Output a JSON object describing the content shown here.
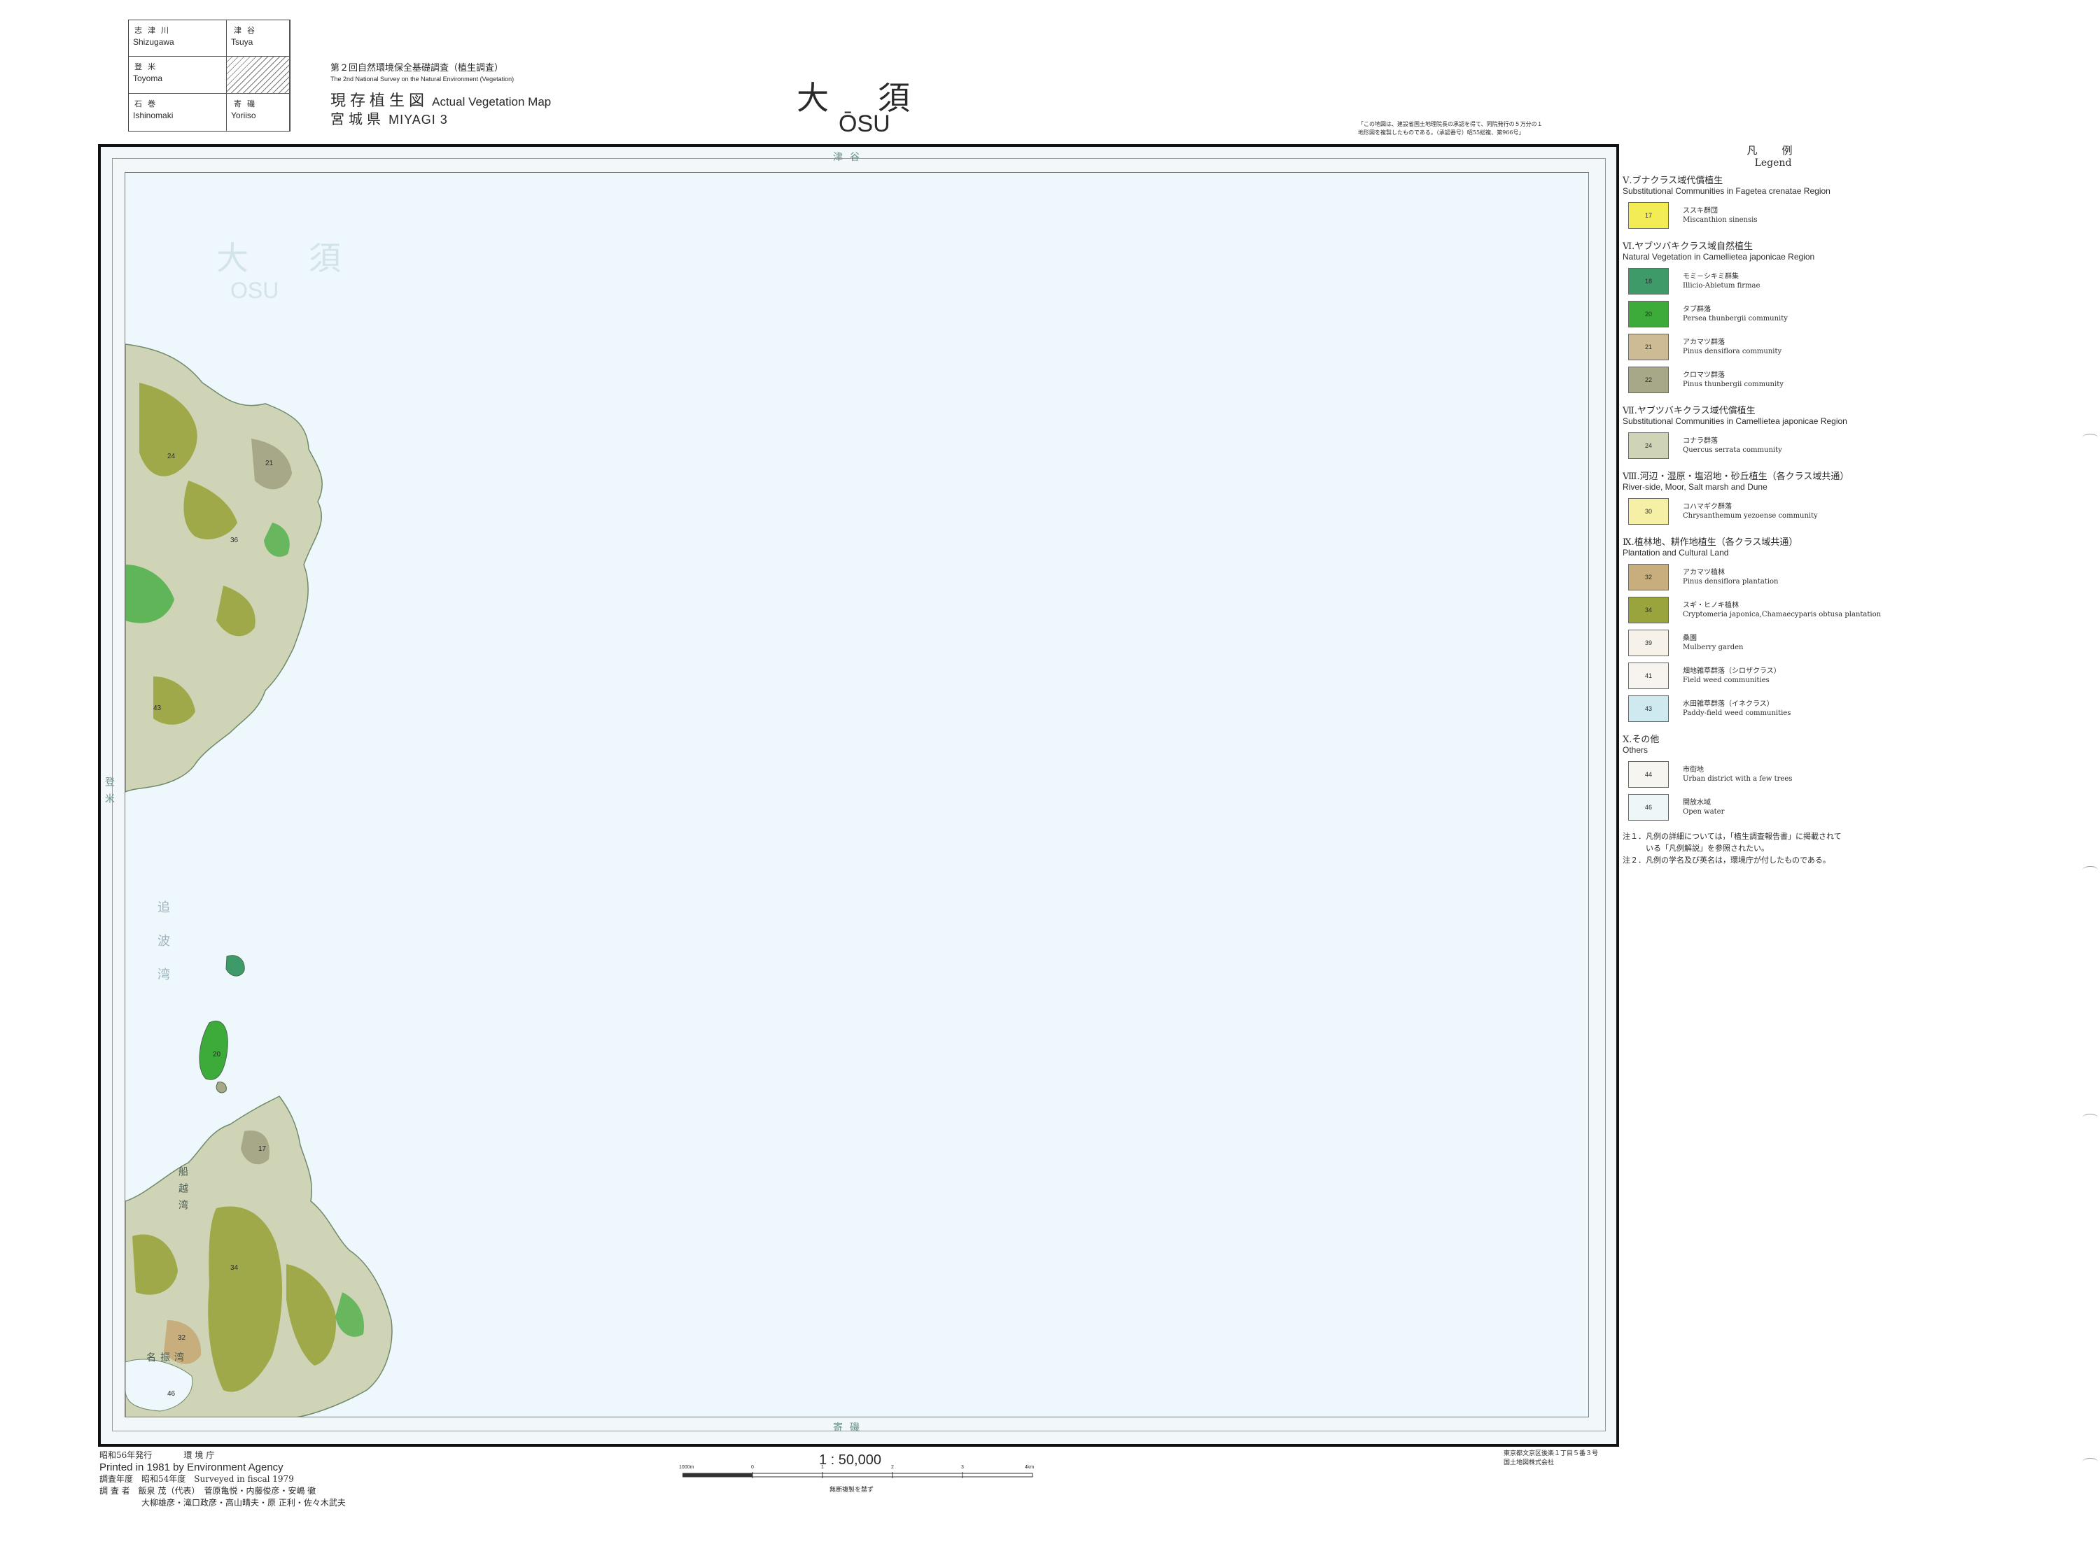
{
  "index_sheet": {
    "cells": [
      {
        "jp": "志津川",
        "en": "Shizugawa"
      },
      {
        "jp": "津谷",
        "en": "Tsuya"
      },
      {
        "jp": "登米",
        "en": "Toyoma"
      },
      {
        "jp": "",
        "en": ""
      },
      {
        "jp": "石巻",
        "en": "Ishinomaki"
      },
      {
        "jp": "寄磯",
        "en": "Yoriiso"
      }
    ]
  },
  "survey": {
    "title_jp": "第２回自然環境保全基礎調査（植生調査）",
    "title_en": "The 2nd National Survey on the Natural Environment (Vegetation)",
    "map_type_jp": "現存植生図",
    "map_type_en": "Actual Vegetation Map",
    "prefecture_jp": "宮城県",
    "prefecture_en": "MIYAGI 3"
  },
  "sheet": {
    "name_jp": "大須",
    "name_en": "ŌSU"
  },
  "copyright_note": [
    "「この地図は、建設省国土地理院長の承認を得て、同院発行の５万分の１",
    "地形図を複製したものである。（承認番号）昭55総複、第966号」"
  ],
  "map": {
    "top_label": "津谷",
    "bottom_label": "寄磯",
    "left_label": "登米",
    "ghost_title_jp": "大　須",
    "ghost_title_en": "OSU",
    "places": [
      "追波湾",
      "船越湾",
      "名振湾"
    ],
    "veg_codes_shown": [
      "24",
      "36",
      "34",
      "20",
      "43",
      "46",
      "32",
      "17",
      "21"
    ]
  },
  "legend": {
    "title_jp": "凡　例",
    "title_en": "Legend",
    "sections": [
      {
        "num": "Ⅴ.",
        "jp": "ブナクラス域代償植生",
        "en": "Substitutional Communities in Fagetea crenatae Region",
        "items": [
          {
            "code": "17",
            "jp": "ススキ群団",
            "en": "Miscanthion sinensis",
            "color": "#f3ec55"
          }
        ]
      },
      {
        "num": "Ⅵ.",
        "jp": "ヤブツバキクラス域自然植生",
        "en": "Natural Vegetation in Camellietea japonicae Region",
        "items": [
          {
            "code": "18",
            "jp": "モミ－シキミ群集",
            "en": "Illicio-Abietum firmae",
            "color": "#3f9a6a"
          },
          {
            "code": "20",
            "jp": "タブ群落",
            "en": "Persea thunbergii community",
            "color": "#3cab3a"
          },
          {
            "code": "21",
            "jp": "アカマツ群落",
            "en": "Pinus densiflora community",
            "color": "#cdbb94"
          },
          {
            "code": "22",
            "jp": "クロマツ群落",
            "en": "Pinus thunbergii community",
            "color": "#a6a888"
          }
        ]
      },
      {
        "num": "Ⅶ.",
        "jp": "ヤブツバキクラス域代償植生",
        "en": "Substitutional Communities in Camellietea japonicae Region",
        "items": [
          {
            "code": "24",
            "jp": "コナラ群落",
            "en": "Quercus serrata community",
            "color": "#cfd4b6"
          }
        ]
      },
      {
        "num": "Ⅷ.",
        "jp": "河辺・湿原・塩沼地・砂丘植生（各クラス域共通）",
        "en": "River-side, Moor, Salt marsh and Dune",
        "items": [
          {
            "code": "30",
            "jp": "コハマギク群落",
            "en": "Chrysanthemum yezoense community",
            "color": "#f6efa6"
          }
        ]
      },
      {
        "num": "Ⅸ.",
        "jp": "植林地、耕作地植生（各クラス域共通）",
        "en": "Plantation and Cultural Land",
        "items": [
          {
            "code": "32",
            "jp": "アカマツ植林",
            "en": "Pinus densiflora plantation",
            "color": "#c9ae7d"
          },
          {
            "code": "34",
            "jp": "スギ・ヒノキ植林",
            "en": "Cryptomeria japonica,Chamaecyparis obtusa plantation",
            "color": "#9aa43d"
          },
          {
            "code": "39",
            "jp": "桑園",
            "en": "Mulberry garden",
            "color": "#f6f2ea"
          },
          {
            "code": "41",
            "jp": "畑地雑草群落（シロザクラス）",
            "en": "Field weed communities",
            "color": "#f7f3ee"
          },
          {
            "code": "43",
            "jp": "水田雑草群落（イネクラス）",
            "en": "Paddy-field weed communities",
            "color": "#cfe9f0"
          }
        ]
      },
      {
        "num": "Ⅹ.",
        "jp": "その他",
        "en": "Others",
        "items": [
          {
            "code": "44",
            "jp": "市街地",
            "en": "Urban district with a few trees",
            "color": "#f7f5ef"
          },
          {
            "code": "46",
            "jp": "開放水域",
            "en": "Open water",
            "color": "#eef7f8"
          }
        ]
      }
    ],
    "notes": [
      "注１．凡例の詳細については，「植生調査報告書」に掲載されて",
      "　　　いる「凡例解説」を参照されたい。",
      "注２．凡例の学名及び英名は，環境庁が付したものである。"
    ]
  },
  "footer": {
    "pub_jp": "昭和56年発行",
    "agency_jp": "環境庁",
    "printed_en": "Printed in 1981 by Environment Agency",
    "survey_year": "調査年度　昭和54年度　Surveyed in fiscal 1979",
    "surveyors_1": "調 査 者　飯泉 茂（代表）　菅原亀悦・内藤俊彦・安嶋 徹",
    "surveyors_2": "　　　　　大柳雄彦・滝口政彦・高山晴夫・原 正利・佐々木武夫",
    "scale": "1 : 50,000",
    "scale_ticks": [
      "1000m",
      "0",
      "1",
      "2",
      "3",
      "4km"
    ],
    "reproduction": "無断複製を禁ず",
    "printer_address": "東京都文京区後楽１丁目５番３号",
    "printer": "国土地図株式会社"
  }
}
